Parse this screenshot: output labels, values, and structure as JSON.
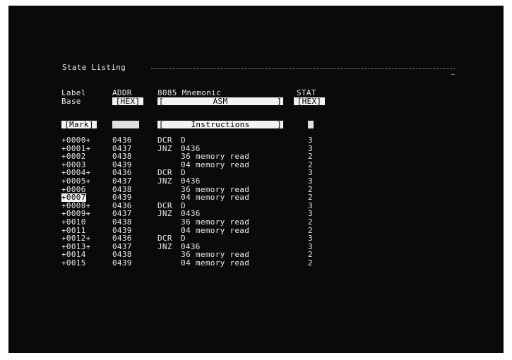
{
  "screen": {
    "title": "State Listing",
    "corner_mark": "─"
  },
  "header": {
    "label_col": "Label",
    "base_col": "Base",
    "addr_col": "ADDR",
    "addr_base": "[HEX]",
    "mnemonic_col": "8085 Mnemonic",
    "mnemonic_base": "ASM",
    "stat_col": "STAT",
    "stat_base": "[HEX]"
  },
  "mark_row": {
    "mark": "[Mark]",
    "instructions": "Instructions"
  },
  "rows": [
    {
      "label": "+0000+",
      "addr": "0436",
      "op": "DCR",
      "arg": "D",
      "mem": "",
      "stat": "3",
      "highlight": false
    },
    {
      "label": "+0001+",
      "addr": "0437",
      "op": "JNZ",
      "arg": "0436",
      "mem": "",
      "stat": "3",
      "highlight": false
    },
    {
      "label": "+0002",
      "addr": "0438",
      "op": "",
      "arg": "36",
      "mem": "memory read",
      "stat": "2",
      "highlight": false
    },
    {
      "label": "+0003",
      "addr": "0439",
      "op": "",
      "arg": "04",
      "mem": "memory read",
      "stat": "2",
      "highlight": false
    },
    {
      "label": "+0004+",
      "addr": "0436",
      "op": "DCR",
      "arg": "D",
      "mem": "",
      "stat": "3",
      "highlight": false
    },
    {
      "label": "+0005+",
      "addr": "0437",
      "op": "JNZ",
      "arg": "0436",
      "mem": "",
      "stat": "3",
      "highlight": false
    },
    {
      "label": "+0006",
      "addr": "0438",
      "op": "",
      "arg": "36",
      "mem": "memory read",
      "stat": "2",
      "highlight": false
    },
    {
      "label": "+0007",
      "addr": "0439",
      "op": "",
      "arg": "04",
      "mem": "memory read",
      "stat": "2",
      "highlight": true
    },
    {
      "label": "+0008+",
      "addr": "0436",
      "op": "DCR",
      "arg": "D",
      "mem": "",
      "stat": "3",
      "highlight": false
    },
    {
      "label": "+0009+",
      "addr": "0437",
      "op": "JNZ",
      "arg": "0436",
      "mem": "",
      "stat": "3",
      "highlight": false
    },
    {
      "label": "+0010",
      "addr": "0438",
      "op": "",
      "arg": "36",
      "mem": "memory read",
      "stat": "2",
      "highlight": false
    },
    {
      "label": "+0011",
      "addr": "0439",
      "op": "",
      "arg": "04",
      "mem": "memory read",
      "stat": "2",
      "highlight": false
    },
    {
      "label": "+0012+",
      "addr": "0436",
      "op": "DCR",
      "arg": "D",
      "mem": "",
      "stat": "3",
      "highlight": false
    },
    {
      "label": "+0013+",
      "addr": "0437",
      "op": "JNZ",
      "arg": "0436",
      "mem": "",
      "stat": "3",
      "highlight": false
    },
    {
      "label": "+0014",
      "addr": "0438",
      "op": "",
      "arg": "36",
      "mem": "memory read",
      "stat": "2",
      "highlight": false
    },
    {
      "label": "+0015",
      "addr": "0439",
      "op": "",
      "arg": "04",
      "mem": "memory read",
      "stat": "2",
      "highlight": false
    }
  ],
  "colors": {
    "screen_bg": "#0a0a0a",
    "text": "#e9e9e9",
    "inverse_bg": "#f2f2f2"
  }
}
